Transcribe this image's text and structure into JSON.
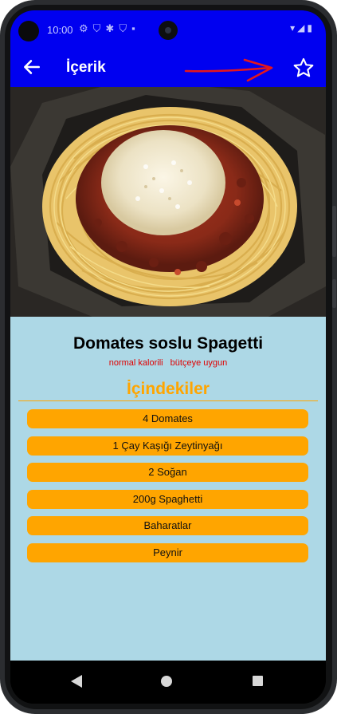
{
  "status_bar": {
    "time": "10:00",
    "left_icons": [
      "gear-icon",
      "shield-icon",
      "settings-icon",
      "shield-icon",
      "sim-icon"
    ],
    "right_icons": [
      "wifi-icon",
      "signal-icon",
      "battery-icon"
    ]
  },
  "app_bar": {
    "title": "İçerik",
    "background": "#0000f0",
    "annotation_arrow_color": "#e5161b"
  },
  "recipe": {
    "name": "Domates soslu Spagetti",
    "tags": [
      "normal kalorili",
      "bütçeye uygun"
    ],
    "image": "spaghetti-bolognese-photo"
  },
  "ingredients": {
    "title": "İçindekiler",
    "items": [
      "4 Domates",
      "1 Çay Kaşığı Zeytinyağı",
      "2 Soğan",
      "200g Spaghetti",
      "Baharatlar",
      "Peynir"
    ]
  },
  "colors": {
    "content_background": "#add8e6",
    "accent": "#ffa500",
    "tag_text": "#e00000"
  }
}
